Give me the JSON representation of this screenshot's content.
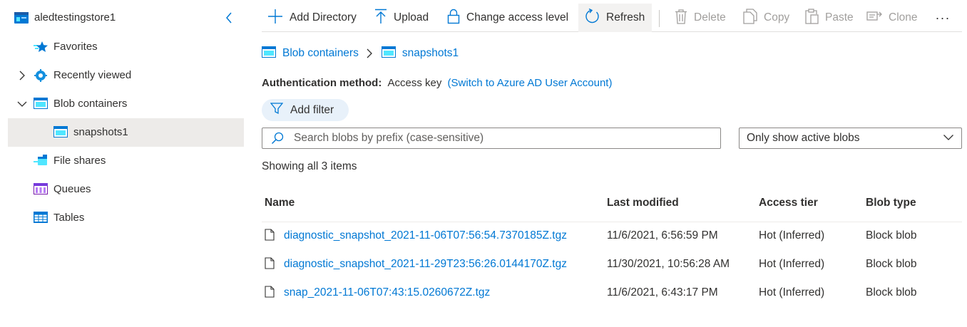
{
  "sidebar": {
    "account": "aledtestingstore1",
    "items": [
      {
        "label": "Favorites",
        "icon": "star-icon"
      },
      {
        "label": "Recently viewed",
        "icon": "gear-icon"
      },
      {
        "label": "Blob containers",
        "icon": "container-icon"
      },
      {
        "label": "snapshots1",
        "icon": "container-icon"
      },
      {
        "label": "File shares",
        "icon": "file-share-icon"
      },
      {
        "label": "Queues",
        "icon": "queue-icon"
      },
      {
        "label": "Tables",
        "icon": "table-icon"
      }
    ]
  },
  "toolbar": {
    "add_directory": "Add Directory",
    "upload": "Upload",
    "change_access": "Change access level",
    "refresh": "Refresh",
    "delete": "Delete",
    "copy": "Copy",
    "paste": "Paste",
    "clone": "Clone",
    "more": "···"
  },
  "breadcrumb": {
    "root": "Blob containers",
    "current": "snapshots1"
  },
  "auth": {
    "label": "Authentication method:",
    "value": "Access key",
    "switch_link": "(Switch to Azure AD User Account)"
  },
  "filter": {
    "label": "Add filter"
  },
  "search": {
    "placeholder": "Search blobs by prefix (case-sensitive)"
  },
  "blob_filter": {
    "selected": "Only show active blobs"
  },
  "count_text": "Showing all 3 items",
  "table": {
    "columns": [
      "Name",
      "Last modified",
      "Access tier",
      "Blob type"
    ],
    "rows": [
      {
        "name": "diagnostic_snapshot_2021-11-06T07:56:54.7370185Z.tgz",
        "modified": "11/6/2021, 6:56:59 PM",
        "tier": "Hot (Inferred)",
        "type": "Block blob"
      },
      {
        "name": "diagnostic_snapshot_2021-11-29T23:56:26.0144170Z.tgz",
        "modified": "11/30/2021, 10:56:28 AM",
        "tier": "Hot (Inferred)",
        "type": "Block blob"
      },
      {
        "name": "snap_2021-11-06T07:43:15.0260672Z.tgz",
        "modified": "11/6/2021, 6:43:17 PM",
        "tier": "Hot (Inferred)",
        "type": "Block blob"
      }
    ]
  },
  "colors": {
    "accent": "#0078d4",
    "selected_bg": "#edebe9",
    "pill_bg": "#e8f1fa"
  }
}
